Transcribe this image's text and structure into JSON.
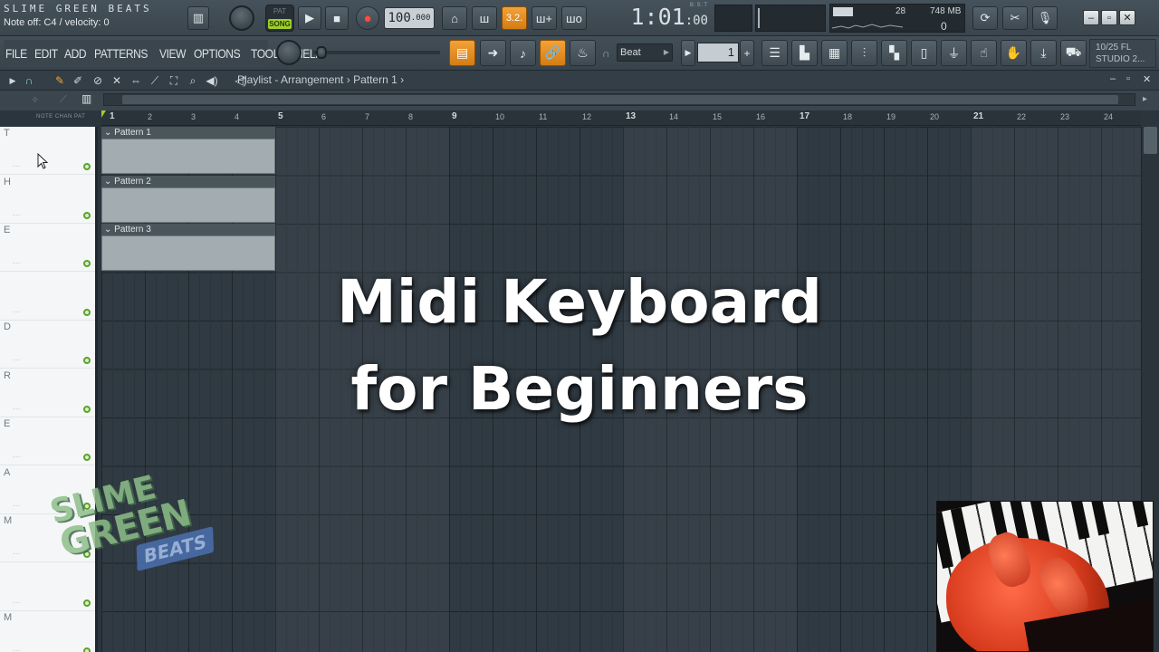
{
  "app": {
    "hint_title": "SLIME GREEN BEATS",
    "hint_status": "Note off: C4 / velocity: 0"
  },
  "transport": {
    "pattern_label": "PAT",
    "song_label": "SONG",
    "play_icon": "play-icon",
    "stop_icon": "stop-icon",
    "record_icon": "record-icon",
    "tempo_main": "100",
    "tempo_dec": ".000",
    "time_main": "1:01",
    "time_sub": ":00",
    "time_format": "B:S:T",
    "precount": "3.2."
  },
  "monitor": {
    "cpu": "28",
    "memory": "748 MB",
    "polyphony": "0"
  },
  "window_buttons": [
    "–",
    "▫",
    "✕"
  ],
  "menu": [
    "FILE",
    "EDIT",
    "ADD",
    "PATTERNS",
    "VIEW",
    "OPTIONS",
    "TOOLS",
    "HELP"
  ],
  "snap": {
    "value": "Beat"
  },
  "pattern_selector": {
    "value": "1"
  },
  "version": {
    "line1": "10/25  FL",
    "line2": "STUDIO 2..."
  },
  "playlist": {
    "title_prefix": "Playlist - Arrangement",
    "separator": "›",
    "title_pattern": "Pattern 1",
    "note_tabs": "NOTE  CHAN  PAT"
  },
  "ruler": [
    "1",
    "2",
    "3",
    "4",
    "5",
    "6",
    "7",
    "8",
    "9",
    "10",
    "11",
    "12",
    "13",
    "14",
    "15",
    "16",
    "17",
    "18",
    "19",
    "20",
    "21",
    "22",
    "23",
    "24"
  ],
  "tracks": [
    "T",
    "H",
    "E",
    "",
    "D",
    "R",
    "E",
    "A",
    "M",
    "",
    "M"
  ],
  "clips": [
    {
      "name": "Pattern 1",
      "track": 0
    },
    {
      "name": "Pattern 2",
      "track": 1
    },
    {
      "name": "Pattern 3",
      "track": 2
    }
  ],
  "overlay": {
    "line1": "Midi Keyboard",
    "line2": "for Beginners"
  },
  "watermark": {
    "line1": "SLIME",
    "line2": "GREEN",
    "line3": "BEATS"
  },
  "colors": {
    "accent": "#f2a23a",
    "song_toggle": "#9ccf2e",
    "track_led": "#5da12a"
  }
}
